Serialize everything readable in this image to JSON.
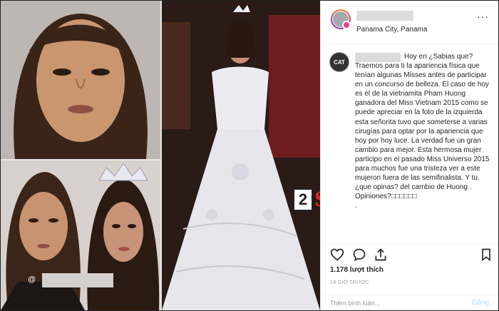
{
  "post": {
    "location": "Panama City, Panama",
    "more_label": "···",
    "comment_lead": "Hoy en ¿Sabias que?",
    "comment_body": "Traemos para ti la apariencia física que tenían algunas Misses antes de participar en un concurso de belleza. El caso de hoy es el de la vietnamita Pham Huong ganadora del Miss Vietnam 2015 como se puede apreciar en la foto de la izquierda esta señorita tuvo que someterse a varias cirugías para optar por la apariencia que hoy por hoy luce. La verdad fue un gran cambio para mejor. Esta hermosa mujer participo en el pasado Miss Universo 2015 para muchos fue una tristeza ver a este mujeron fuera de las semifinalista. Y tu. ¿que opinas? del cambio de Huong .\nOpiniones?□□□□□□\n.",
    "cat_avatar_label": "CAT",
    "likes": "1.178 lượt thích",
    "time": "19 GIỜ TRƯỚC",
    "add_comment_placeholder": "Thêm bình luận...",
    "post_button": "Đăng"
  },
  "photos": {
    "watermark_digit": "2",
    "watermark_text": "Sao",
    "tag_prefix": "@"
  },
  "icons": {
    "like": "heart-icon",
    "comment": "comment-icon",
    "share": "share-icon",
    "save": "bookmark-icon"
  },
  "colors": {
    "watermark_red": "#e0262a",
    "story_pink": "#e84393"
  }
}
